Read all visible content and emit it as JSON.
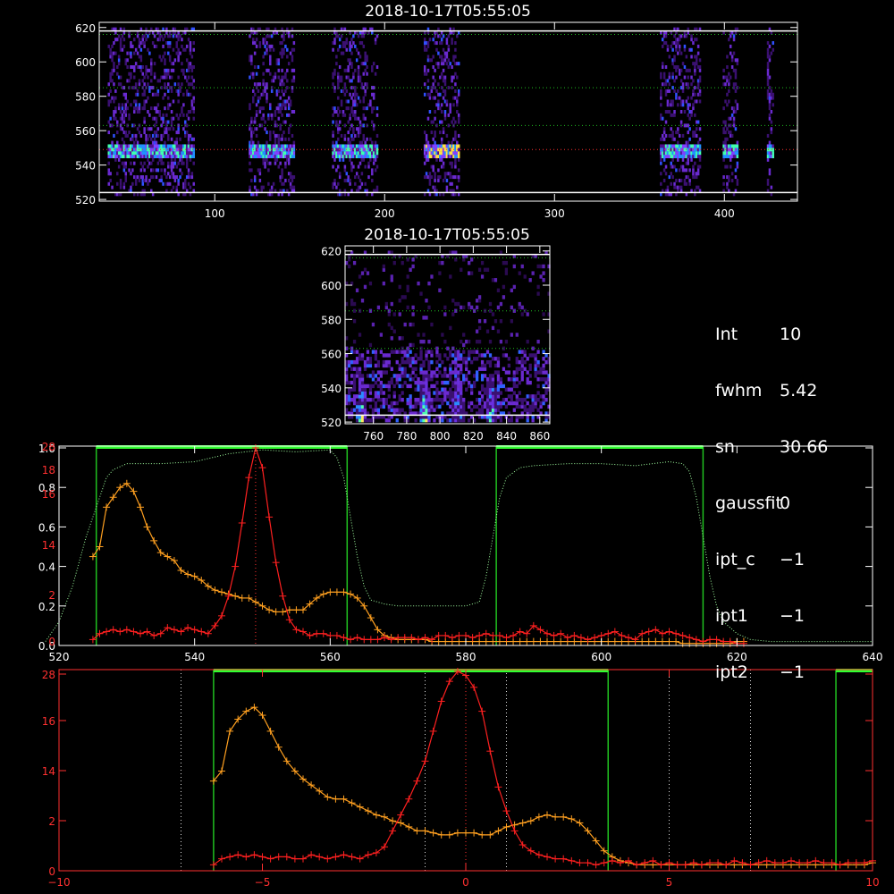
{
  "panel_top": {
    "title": "2018-10-17T05:55:05"
  },
  "panel_zoom": {
    "title": "2018-10-17T05:55:05"
  },
  "info": [
    {
      "key": "Int",
      "value": "10"
    },
    {
      "key": "fwhm",
      "value": "5.42"
    },
    {
      "key": "sn",
      "value": "30.66"
    },
    {
      "key": "gaussfit",
      "value": "0"
    },
    {
      "key": "ipt_c",
      "value": "−1"
    },
    {
      "key": "ipt1",
      "value": "−1"
    },
    {
      "key": "ipt2",
      "value": "−1"
    }
  ],
  "colors": {
    "axis_white": "#ffffff",
    "axis_red": "#ff3030",
    "orange": "#ffa020",
    "red": "#ff2020",
    "green": "#30ff30",
    "green_thin": "#20c020",
    "green_dotted": "#a0ffa0",
    "red_dotted": "#ff3030"
  },
  "chart_data": [
    {
      "type": "heatmap",
      "title": "2018-10-17T05:55:05",
      "xlim": [
        32,
        443
      ],
      "ylim": [
        519,
        623
      ],
      "x_ticks": [
        100,
        200,
        300,
        400
      ],
      "y_ticks": [
        520,
        540,
        560,
        580,
        600,
        620
      ],
      "active_x_bands": [
        [
          37,
          88
        ],
        [
          120,
          147
        ],
        [
          169,
          196
        ],
        [
          223,
          244
        ],
        [
          362,
          386
        ],
        [
          399,
          408
        ],
        [
          425,
          429
        ]
      ],
      "emission_row_y": 548,
      "hlines_white": [
        524,
        618
      ],
      "hlines_green_dotted": [
        563,
        585,
        616
      ],
      "hline_red_dotted": 549
    },
    {
      "type": "heatmap",
      "title": "2018-10-17T05:55:05",
      "xlim": [
        743,
        866
      ],
      "ylim": [
        519,
        623
      ],
      "x_ticks": [
        760,
        780,
        800,
        820,
        840,
        860
      ],
      "y_ticks": [
        520,
        540,
        560,
        580,
        600,
        620
      ],
      "hot_columns_x": [
        752,
        790,
        810,
        830
      ],
      "hlines_white": [
        524,
        618
      ],
      "hlines_green_dotted": [
        563,
        585,
        616
      ]
    },
    {
      "type": "line",
      "xlim": [
        520,
        640
      ],
      "x_ticks": [
        520,
        540,
        560,
        580,
        600,
        620,
        640
      ],
      "left_ticks_white": [
        "0.0",
        "0.2",
        "0.4",
        "0.6",
        "0.8",
        "1.0"
      ],
      "left_ticks_red": [
        "0",
        "2",
        "14",
        "16",
        "18",
        "28"
      ],
      "green_windows": [
        [
          525.5,
          562.5
        ],
        [
          584.5,
          615
        ]
      ],
      "red_dotted_x": 549,
      "series": [
        {
          "color": "orange",
          "x": [
            525,
            526,
            527,
            528,
            529,
            530,
            531,
            532,
            533,
            534,
            535,
            536,
            537,
            538,
            539,
            540,
            541,
            542,
            543,
            544,
            545,
            546,
            547,
            548,
            549,
            550,
            551,
            552,
            553,
            554,
            555,
            556,
            557,
            558,
            559,
            560,
            561,
            562,
            563,
            564,
            565,
            566,
            567,
            568,
            569,
            570,
            571,
            572,
            573,
            574,
            575,
            576,
            577,
            578,
            579,
            580,
            581,
            582,
            583,
            584,
            585,
            586,
            587,
            588,
            589,
            590,
            591,
            592,
            593,
            594,
            595,
            596,
            597,
            598,
            599,
            600,
            601,
            602,
            603,
            604,
            605,
            606,
            607,
            608,
            609,
            610,
            611,
            612,
            613,
            614,
            615,
            616,
            617,
            618,
            619,
            620,
            621
          ],
          "y": [
            0.45,
            0.5,
            0.7,
            0.75,
            0.8,
            0.82,
            0.78,
            0.7,
            0.6,
            0.53,
            0.47,
            0.45,
            0.43,
            0.38,
            0.36,
            0.35,
            0.33,
            0.3,
            0.28,
            0.27,
            0.26,
            0.25,
            0.24,
            0.24,
            0.22,
            0.2,
            0.18,
            0.17,
            0.17,
            0.18,
            0.18,
            0.18,
            0.21,
            0.24,
            0.26,
            0.27,
            0.27,
            0.27,
            0.26,
            0.24,
            0.2,
            0.14,
            0.08,
            0.05,
            0.04,
            0.03,
            0.03,
            0.03,
            0.03,
            0.03,
            0.02,
            0.02,
            0.02,
            0.02,
            0.02,
            0.02,
            0.02,
            0.02,
            0.02,
            0.02,
            0.02,
            0.02,
            0.02,
            0.02,
            0.02,
            0.02,
            0.02,
            0.02,
            0.02,
            0.02,
            0.02,
            0.02,
            0.02,
            0.02,
            0.02,
            0.02,
            0.02,
            0.02,
            0.02,
            0.02,
            0.02,
            0.02,
            0.02,
            0.02,
            0.02,
            0.02,
            0.02,
            0.01,
            0.01,
            0.01,
            0.01,
            0.01,
            0.01,
            0.01,
            0.01,
            0.02,
            0.02
          ]
        },
        {
          "color": "red",
          "x": [
            525,
            526,
            527,
            528,
            529,
            530,
            531,
            532,
            533,
            534,
            535,
            536,
            537,
            538,
            539,
            540,
            541,
            542,
            543,
            544,
            545,
            546,
            547,
            548,
            549,
            550,
            551,
            552,
            553,
            554,
            555,
            556,
            557,
            558,
            559,
            560,
            561,
            562,
            563,
            564,
            565,
            566,
            567,
            568,
            569,
            570,
            571,
            572,
            573,
            574,
            575,
            576,
            577,
            578,
            579,
            580,
            581,
            582,
            583,
            584,
            585,
            586,
            587,
            588,
            589,
            590,
            591,
            592,
            593,
            594,
            595,
            596,
            597,
            598,
            599,
            600,
            601,
            602,
            603,
            604,
            605,
            606,
            607,
            608,
            609,
            610,
            611,
            612,
            613,
            614,
            615,
            616,
            617,
            618,
            619,
            620,
            621
          ],
          "y": [
            0.03,
            0.06,
            0.07,
            0.08,
            0.07,
            0.08,
            0.07,
            0.06,
            0.07,
            0.05,
            0.06,
            0.09,
            0.08,
            0.07,
            0.09,
            0.08,
            0.07,
            0.06,
            0.1,
            0.15,
            0.25,
            0.4,
            0.62,
            0.85,
            1.0,
            0.9,
            0.65,
            0.42,
            0.25,
            0.13,
            0.08,
            0.07,
            0.05,
            0.06,
            0.06,
            0.05,
            0.05,
            0.04,
            0.03,
            0.04,
            0.03,
            0.03,
            0.03,
            0.04,
            0.03,
            0.04,
            0.04,
            0.04,
            0.03,
            0.04,
            0.03,
            0.05,
            0.05,
            0.04,
            0.05,
            0.05,
            0.04,
            0.05,
            0.06,
            0.05,
            0.05,
            0.04,
            0.05,
            0.07,
            0.06,
            0.1,
            0.08,
            0.06,
            0.05,
            0.06,
            0.04,
            0.05,
            0.04,
            0.03,
            0.04,
            0.05,
            0.06,
            0.07,
            0.05,
            0.04,
            0.03,
            0.06,
            0.07,
            0.08,
            0.06,
            0.07,
            0.06,
            0.05,
            0.04,
            0.03,
            0.02,
            0.03,
            0.03,
            0.02,
            0.02,
            0.01,
            0.01
          ]
        },
        {
          "color": "green_dotted",
          "x": [
            518,
            520,
            522,
            524,
            526,
            527,
            528,
            530,
            532,
            535,
            540,
            545,
            550,
            555,
            560,
            561,
            562,
            563,
            564,
            565,
            566,
            568,
            570,
            575,
            580,
            582,
            583,
            584,
            585,
            586,
            588,
            590,
            595,
            600,
            605,
            610,
            612,
            613,
            614,
            615,
            616,
            617,
            618,
            620,
            622,
            625,
            630,
            635,
            640
          ],
          "y": [
            0.02,
            0.12,
            0.3,
            0.55,
            0.75,
            0.85,
            0.89,
            0.92,
            0.92,
            0.92,
            0.93,
            0.97,
            0.99,
            0.98,
            0.99,
            0.95,
            0.85,
            0.65,
            0.45,
            0.3,
            0.23,
            0.21,
            0.2,
            0.2,
            0.2,
            0.22,
            0.35,
            0.55,
            0.75,
            0.85,
            0.9,
            0.91,
            0.92,
            0.92,
            0.91,
            0.93,
            0.92,
            0.88,
            0.75,
            0.55,
            0.35,
            0.2,
            0.12,
            0.06,
            0.03,
            0.02,
            0.02,
            0.02,
            0.02
          ]
        }
      ]
    },
    {
      "type": "line",
      "xlim": [
        -10,
        10
      ],
      "x_ticks": [
        -10,
        -5,
        0,
        5,
        10
      ],
      "left_ticks_red": [
        "0",
        "2",
        "14",
        "16",
        "28"
      ],
      "green_windows": [
        [
          -6.2,
          3.5
        ],
        [
          9.1,
          10.5
        ]
      ],
      "white_dotted_x": [
        -7,
        -1,
        1,
        5,
        7
      ],
      "red_dotted_x": 0,
      "series": [
        {
          "color": "orange",
          "x": [
            -6.2,
            -6.0,
            -5.8,
            -5.6,
            -5.4,
            -5.2,
            -5.0,
            -4.8,
            -4.6,
            -4.4,
            -4.2,
            -4.0,
            -3.8,
            -3.6,
            -3.4,
            -3.2,
            -3.0,
            -2.8,
            -2.6,
            -2.4,
            -2.2,
            -2.0,
            -1.8,
            -1.6,
            -1.4,
            -1.2,
            -1.0,
            -0.8,
            -0.6,
            -0.4,
            -0.2,
            0.0,
            0.2,
            0.4,
            0.6,
            0.8,
            1.0,
            1.2,
            1.4,
            1.6,
            1.8,
            2.0,
            2.2,
            2.4,
            2.6,
            2.8,
            3.0,
            3.2,
            3.4,
            3.6,
            3.8,
            4.0,
            4.2,
            4.4,
            4.6,
            4.8,
            5.0,
            5.2,
            5.4,
            5.6,
            5.8,
            6.0,
            6.2,
            6.4,
            6.6,
            6.8,
            7.0,
            7.2,
            7.4,
            7.6,
            7.8,
            8.0,
            8.2,
            8.4,
            8.6,
            8.8,
            9.0,
            9.2,
            9.4,
            9.6,
            9.8,
            10.0
          ],
          "y": [
            0.45,
            0.5,
            0.7,
            0.76,
            0.8,
            0.82,
            0.78,
            0.7,
            0.62,
            0.55,
            0.5,
            0.46,
            0.43,
            0.4,
            0.37,
            0.36,
            0.36,
            0.34,
            0.32,
            0.3,
            0.28,
            0.27,
            0.25,
            0.24,
            0.22,
            0.2,
            0.2,
            0.19,
            0.18,
            0.18,
            0.19,
            0.19,
            0.19,
            0.18,
            0.18,
            0.2,
            0.22,
            0.23,
            0.24,
            0.25,
            0.27,
            0.28,
            0.27,
            0.27,
            0.26,
            0.24,
            0.2,
            0.15,
            0.1,
            0.07,
            0.05,
            0.04,
            0.03,
            0.03,
            0.03,
            0.03,
            0.03,
            0.03,
            0.03,
            0.03,
            0.03,
            0.03,
            0.03,
            0.03,
            0.03,
            0.03,
            0.03,
            0.03,
            0.03,
            0.03,
            0.03,
            0.03,
            0.03,
            0.03,
            0.03,
            0.03,
            0.03,
            0.03,
            0.03,
            0.03,
            0.03,
            0.04
          ]
        },
        {
          "color": "red",
          "x": [
            -6.2,
            -6.0,
            -5.8,
            -5.6,
            -5.4,
            -5.2,
            -5.0,
            -4.8,
            -4.6,
            -4.4,
            -4.2,
            -4.0,
            -3.8,
            -3.6,
            -3.4,
            -3.2,
            -3.0,
            -2.8,
            -2.6,
            -2.4,
            -2.2,
            -2.0,
            -1.8,
            -1.6,
            -1.4,
            -1.2,
            -1.0,
            -0.8,
            -0.6,
            -0.4,
            -0.2,
            0.0,
            0.2,
            0.4,
            0.6,
            0.8,
            1.0,
            1.2,
            1.4,
            1.6,
            1.8,
            2.0,
            2.2,
            2.4,
            2.6,
            2.8,
            3.0,
            3.2,
            3.4,
            3.6,
            3.8,
            4.0,
            4.2,
            4.4,
            4.6,
            4.8,
            5.0,
            5.2,
            5.4,
            5.6,
            5.8,
            6.0,
            6.2,
            6.4,
            6.6,
            6.8,
            7.0,
            7.2,
            7.4,
            7.6,
            7.8,
            8.0,
            8.2,
            8.4,
            8.6,
            8.8,
            9.0,
            9.2,
            9.4,
            9.6,
            9.8,
            10.0
          ],
          "y": [
            0.03,
            0.06,
            0.07,
            0.08,
            0.07,
            0.08,
            0.07,
            0.06,
            0.07,
            0.07,
            0.06,
            0.06,
            0.08,
            0.07,
            0.06,
            0.07,
            0.08,
            0.07,
            0.06,
            0.08,
            0.09,
            0.12,
            0.2,
            0.28,
            0.36,
            0.45,
            0.55,
            0.7,
            0.85,
            0.95,
            1.0,
            0.98,
            0.92,
            0.8,
            0.6,
            0.42,
            0.3,
            0.2,
            0.13,
            0.1,
            0.08,
            0.07,
            0.06,
            0.06,
            0.05,
            0.04,
            0.04,
            0.03,
            0.04,
            0.05,
            0.04,
            0.05,
            0.03,
            0.04,
            0.05,
            0.03,
            0.04,
            0.03,
            0.03,
            0.04,
            0.03,
            0.04,
            0.04,
            0.03,
            0.05,
            0.04,
            0.03,
            0.04,
            0.05,
            0.04,
            0.04,
            0.05,
            0.04,
            0.04,
            0.05,
            0.04,
            0.04,
            0.03,
            0.04,
            0.04,
            0.04,
            0.05
          ]
        }
      ]
    }
  ]
}
